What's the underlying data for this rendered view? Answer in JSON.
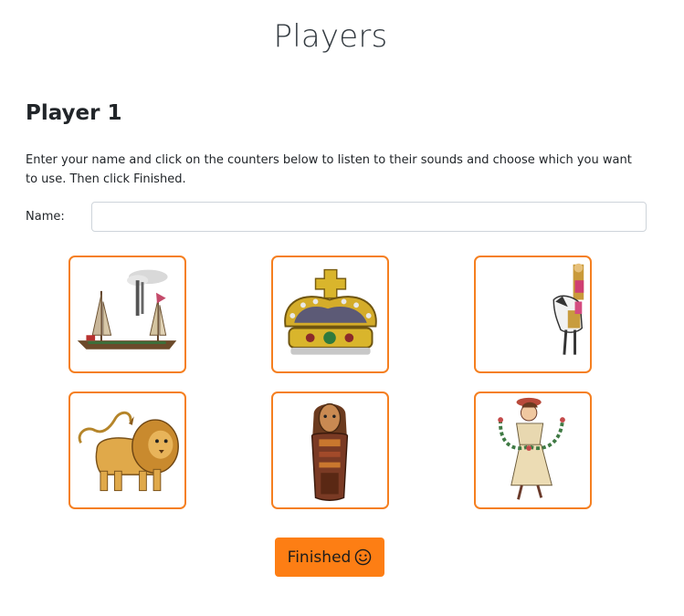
{
  "page": {
    "title": "Players"
  },
  "player": {
    "heading": "Player 1",
    "instructions": "Enter your name and click on the counters below to listen to their sounds and choose which you want to use. Then click Finished.",
    "name_label": "Name:",
    "name_value": "",
    "name_placeholder": ""
  },
  "counters": [
    {
      "icon": "steamboat-icon"
    },
    {
      "icon": "crown-icon"
    },
    {
      "icon": "horse-rider-icon"
    },
    {
      "icon": "lion-icon"
    },
    {
      "icon": "mummy-icon"
    },
    {
      "icon": "garland-lady-icon"
    }
  ],
  "finished_button": {
    "label": "Finished",
    "icon": "smiley-icon"
  },
  "colors": {
    "accent": "#fd7e14",
    "counter_border": "#f57f20"
  }
}
